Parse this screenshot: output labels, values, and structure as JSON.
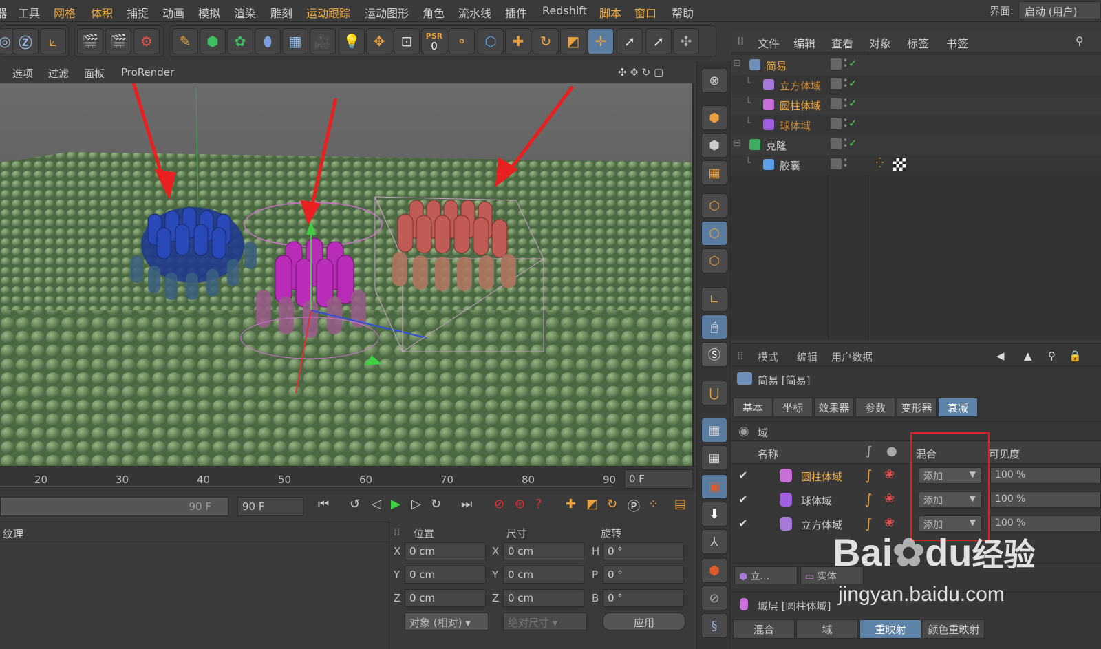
{
  "menubar": {
    "items": [
      {
        "label": "器",
        "highlight": false
      },
      {
        "label": "工具",
        "highlight": false
      },
      {
        "label": "网格",
        "highlight": true
      },
      {
        "label": "体积",
        "highlight": true
      },
      {
        "label": "捕捉",
        "highlight": false
      },
      {
        "label": "动画",
        "highlight": false
      },
      {
        "label": "模拟",
        "highlight": false
      },
      {
        "label": "渲染",
        "highlight": false
      },
      {
        "label": "雕刻",
        "highlight": false
      },
      {
        "label": "运动跟踪",
        "highlight": true
      },
      {
        "label": "运动图形",
        "highlight": false
      },
      {
        "label": "角色",
        "highlight": false
      },
      {
        "label": "流水线",
        "highlight": false
      },
      {
        "label": "插件",
        "highlight": false
      },
      {
        "label": "Redshift",
        "highlight": false
      },
      {
        "label": "脚本",
        "highlight": true
      },
      {
        "label": "窗口",
        "highlight": true
      },
      {
        "label": "帮助",
        "highlight": false
      }
    ],
    "layout_label": "界面:",
    "layout_value": "启动 (用户)"
  },
  "toolbar": {
    "psr_label": "PSR",
    "psr_value": "0"
  },
  "viewport_menu": {
    "items": [
      "选项",
      "过滤",
      "面板",
      "ProRender"
    ]
  },
  "object_manager": {
    "menu": [
      {
        "label": "文件",
        "highlight": true
      },
      {
        "label": "编辑",
        "highlight": false
      },
      {
        "label": "查看",
        "highlight": false
      },
      {
        "label": "对象",
        "highlight": true
      },
      {
        "label": "标签",
        "highlight": true
      },
      {
        "label": "书签",
        "highlight": false
      }
    ],
    "tree": [
      {
        "name": "简易",
        "indent": 0,
        "color": "#f0a93a",
        "icon": "group-icon",
        "iconColor": "#6f8fb8",
        "check": true
      },
      {
        "name": "立方体域",
        "indent": 1,
        "color": "#d08a35",
        "icon": "cube-field-icon",
        "iconColor": "#a678d8",
        "check": true
      },
      {
        "name": "圆柱体域",
        "indent": 1,
        "color": "#f0a93a",
        "icon": "cylinder-field-icon",
        "iconColor": "#c86fd8",
        "check": true
      },
      {
        "name": "球体域",
        "indent": 1,
        "color": "#d08a35",
        "icon": "sphere-field-icon",
        "iconColor": "#a060e0",
        "check": true
      },
      {
        "name": "克隆",
        "indent": 0,
        "color": "#cfcfcf",
        "icon": "cloner-icon",
        "iconColor": "#3fae5f",
        "check": true
      },
      {
        "name": "胶囊",
        "indent": 1,
        "color": "#cfcfcf",
        "icon": "capsule-icon",
        "iconColor": "#5ba0e8",
        "check": false
      }
    ]
  },
  "attribute_manager": {
    "menu": [
      "模式",
      "编辑",
      "用户数据"
    ],
    "title": "简易 [简易]",
    "tabs": [
      {
        "label": "基本",
        "active": false
      },
      {
        "label": "坐标",
        "active": false
      },
      {
        "label": "效果器",
        "active": false
      },
      {
        "label": "参数",
        "active": false
      },
      {
        "label": "变形器",
        "active": false
      },
      {
        "label": "衰减",
        "active": true
      }
    ],
    "section_label": "域",
    "col_name": "名称",
    "col_blend": "混合",
    "col_visibility": "可见度",
    "fields": [
      {
        "name": "圆柱体域",
        "color": "#f0a93a",
        "icon": "cylinder-field-icon",
        "blend": "添加",
        "visibility": "100 %"
      },
      {
        "name": "球体域",
        "color": "#cfcfcf",
        "icon": "sphere-field-icon",
        "blend": "添加",
        "visibility": "100 %"
      },
      {
        "name": "立方体域",
        "color": "#cfcfcf",
        "icon": "cube-field-icon",
        "blend": "添加",
        "visibility": "100 %"
      }
    ],
    "bottom_tab_1": "立...",
    "bottom_tab_2": "实体",
    "layer_label": "域层 [圆柱体域]",
    "bottom_tabs": [
      {
        "label": "混合",
        "active": false
      },
      {
        "label": "域",
        "active": false
      },
      {
        "label": "重映射",
        "active": true
      },
      {
        "label": "颜色重映射",
        "active": false
      }
    ]
  },
  "timeline": {
    "ticks": [
      "20",
      "30",
      "40",
      "50",
      "60",
      "70",
      "80",
      "90"
    ],
    "current_frame": "0 F",
    "end_frame": "90 F",
    "end_frame_field": "90 F"
  },
  "material": {
    "label": "纹理"
  },
  "coords": {
    "headers": [
      "位置",
      "尺寸",
      "旋转"
    ],
    "position": [
      {
        "axis": "X",
        "value": "0 cm"
      },
      {
        "axis": "Y",
        "value": "0 cm"
      },
      {
        "axis": "Z",
        "value": "0 cm"
      }
    ],
    "size": [
      {
        "axis": "X",
        "value": "0 cm"
      },
      {
        "axis": "Y",
        "value": "0 cm"
      },
      {
        "axis": "Z",
        "value": "0 cm"
      }
    ],
    "rotation": [
      {
        "axis": "H",
        "value": "0 °"
      },
      {
        "axis": "P",
        "value": "0 °"
      },
      {
        "axis": "B",
        "value": "0 °"
      }
    ],
    "mode_select": "对象 (相对)",
    "size_select": "绝对尺寸",
    "apply_button": "应用"
  },
  "watermark": {
    "brand": "Bai",
    "brand2": "du",
    "cn": "经验",
    "url": "jingyan.baidu.com"
  }
}
